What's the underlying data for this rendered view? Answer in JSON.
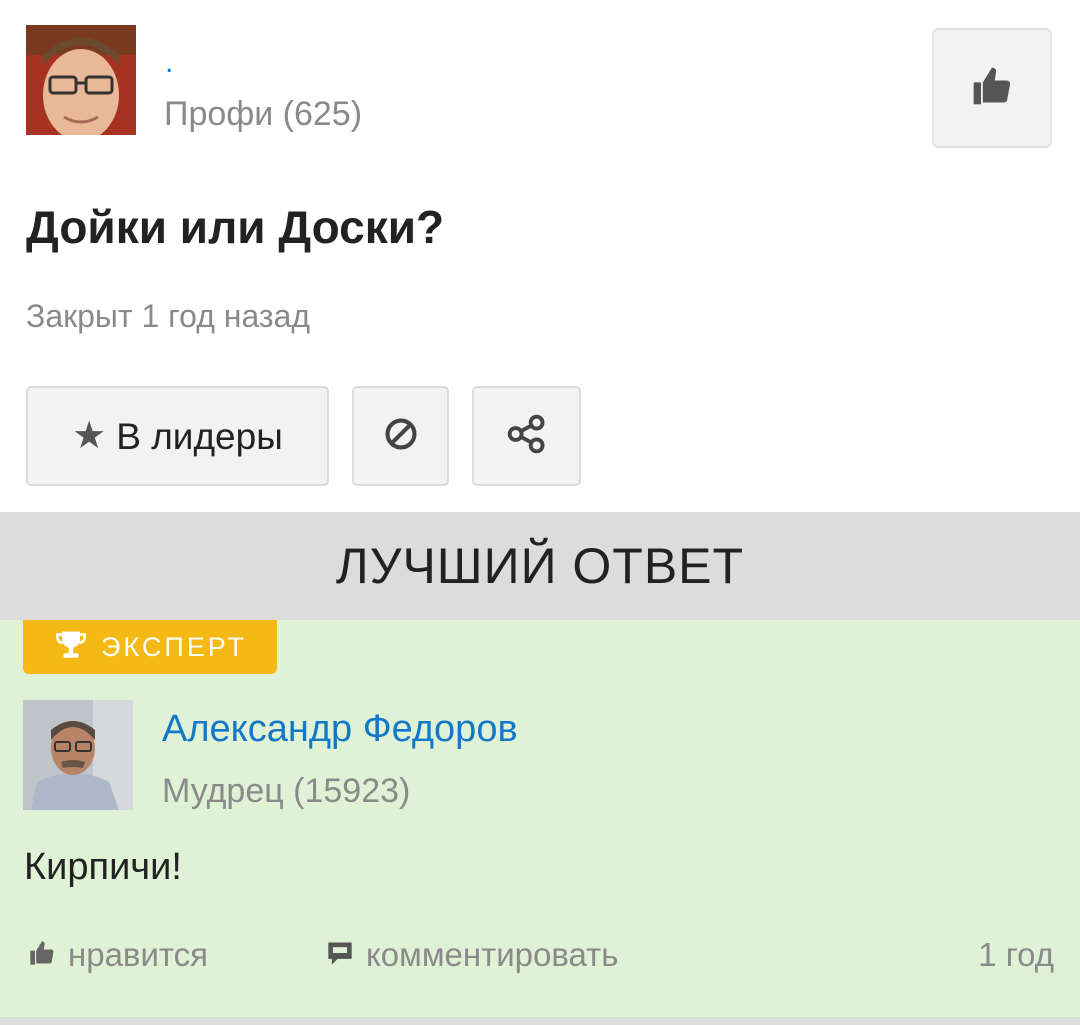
{
  "question": {
    "author": {
      "name": ".",
      "rank": "Профи (625)"
    },
    "title": "Дойки или Доски?",
    "status": "Закрыт 1 год назад",
    "buttons": {
      "leaders_label": "В лидеры"
    }
  },
  "best_answer": {
    "header": "ЛУЧШИЙ ОТВЕТ",
    "badge": "ЭКСПЕРТ",
    "author": {
      "name": "Александр Федоров",
      "rank": "Мудрец (15923)"
    },
    "text": "Кирпичи!",
    "actions": {
      "like_label": "нравится",
      "comment_label": "комментировать",
      "time": "1 год"
    }
  },
  "colors": {
    "link": "#1478c8",
    "muted": "#8a8a8a",
    "answer_bg": "#e0f2d6",
    "badge": "#f5b915",
    "header_bg": "#dcdcdc"
  },
  "icons": [
    "like-icon",
    "star-icon",
    "block-icon",
    "share-icon",
    "trophy-icon",
    "comment-icon"
  ]
}
